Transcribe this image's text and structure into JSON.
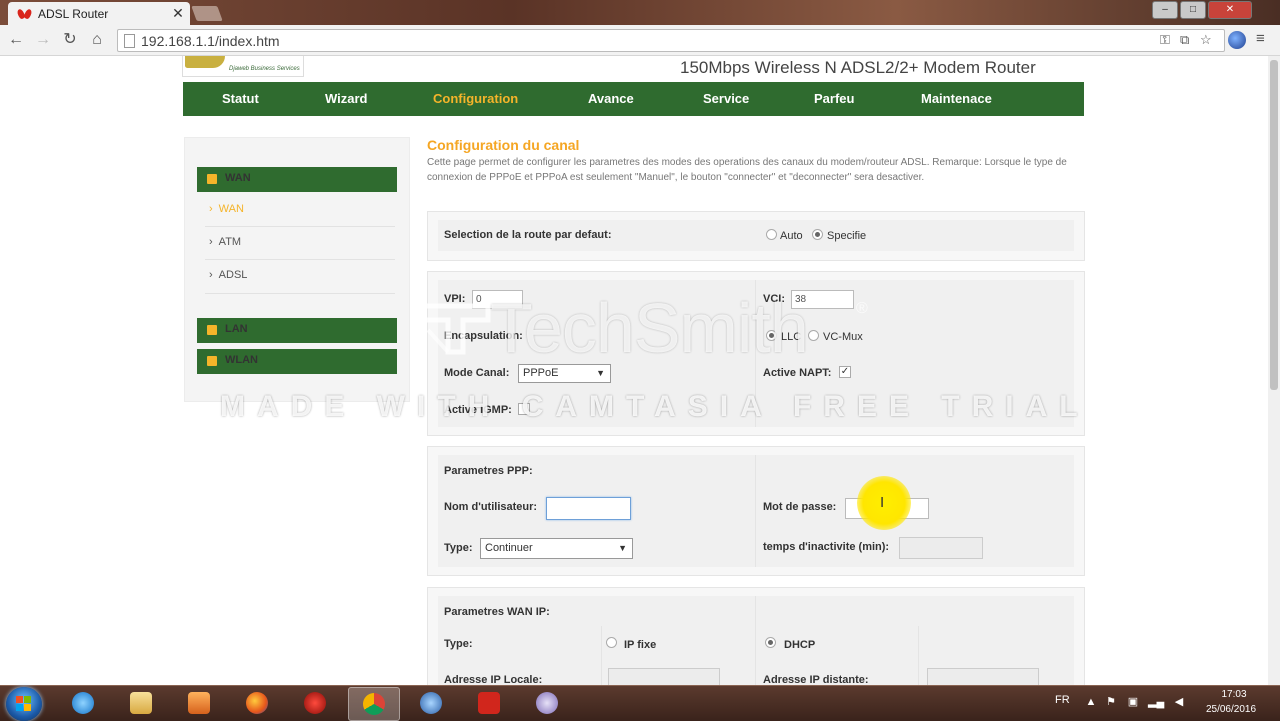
{
  "browser": {
    "tab_title": "ADSL Router",
    "url": "192.168.1.1/index.htm"
  },
  "header": {
    "logo_text": "Djaweb Business Services",
    "model_title": "150Mbps Wireless N ADSL2/2+ Modem Router"
  },
  "nav": {
    "items": [
      "Statut",
      "Wizard",
      "Configuration",
      "Avance",
      "Service",
      "Parfeu",
      "Maintenace"
    ],
    "active": "Configuration"
  },
  "sidebar": {
    "wan_header": "WAN",
    "wan_items": [
      "WAN",
      "ATM",
      "ADSL"
    ],
    "active_item": "WAN",
    "lan_header": "LAN",
    "wlan_header": "WLAN"
  },
  "content": {
    "title": "Configuration du canal",
    "description": "Cette page permet de configurer les parametres des modes des operations des canaux du modem/routeur ADSL. Remarque: Lorsque le type de connexion de PPPoE et PPPoA est seulement \"Manuel\", le bouton \"connecter\" et \"deconnecter\" sera desactiver.",
    "route": {
      "label": "Selection de la route par defaut:",
      "opt_auto": "Auto",
      "opt_specific": "Specifie",
      "selected": "Specifie"
    },
    "channel": {
      "vpi_label": "VPI:",
      "vpi_value": "0",
      "vci_label": "VCI:",
      "vci_value": "38",
      "encap_label": "Encapsulation:",
      "encap_llc": "LLC",
      "encap_vcmux": "VC-Mux",
      "encap_selected": "LLC",
      "mode_label": "Mode Canal:",
      "mode_value": "PPPoE",
      "napt_label": "Active NAPT:",
      "napt_checked": true,
      "igmp_label": "Active IGMP:",
      "igmp_checked": false
    },
    "ppp": {
      "section_title": "Parametres PPP:",
      "user_label": "Nom d'utilisateur:",
      "user_value": "",
      "pass_label": "Mot de passe:",
      "pass_value": "",
      "type_label": "Type:",
      "type_value": "Continuer",
      "idle_label": "temps d'inactivite (min):",
      "idle_value": ""
    },
    "wanip": {
      "section_title": "Parametres WAN IP:",
      "type_label": "Type:",
      "opt_fixed": "IP fixe",
      "opt_dhcp": "DHCP",
      "selected": "DHCP",
      "local_ip_label": "Adresse IP Locale:",
      "remote_ip_label": "Adresse IP distante:"
    }
  },
  "watermark": {
    "brand": "TechSmith",
    "reg": "®",
    "trial": "MADE WITH CAMTASIA FREE TRIAL"
  },
  "taskbar": {
    "lang": "FR",
    "time": "17:03",
    "date": "25/06/2016"
  },
  "colors": {
    "nav_green": "#2f6b2f",
    "accent_orange": "#f5a623",
    "cursor_yellow": "#ffe600"
  }
}
